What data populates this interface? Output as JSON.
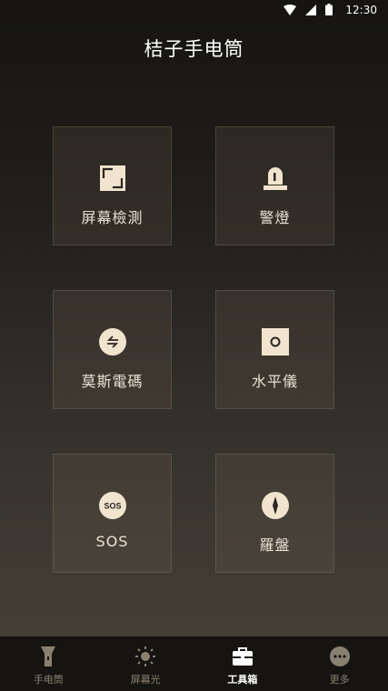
{
  "status_bar": {
    "time": "12:30",
    "icons": [
      "wifi-icon",
      "signal-icon",
      "battery-icon"
    ]
  },
  "app": {
    "title": "桔子手电筒"
  },
  "tools": [
    {
      "label": "屏幕檢測",
      "icon": "screen-frame-icon"
    },
    {
      "label": "警燈",
      "icon": "siren-icon"
    },
    {
      "label": "莫斯電碼",
      "icon": "swap-arrows-icon"
    },
    {
      "label": "水平儀",
      "icon": "level-icon"
    },
    {
      "label": "SOS",
      "icon": "sos-icon",
      "badge": "SOS"
    },
    {
      "label": "羅盤",
      "icon": "compass-icon"
    }
  ],
  "tab_bar": {
    "active_index": 2,
    "tabs": [
      {
        "label": "手电筒",
        "icon": "flashlight-icon"
      },
      {
        "label": "屏幕光",
        "icon": "sun-icon"
      },
      {
        "label": "工具箱",
        "icon": "toolbox-icon"
      },
      {
        "label": "更多",
        "icon": "more-icon"
      }
    ]
  },
  "colors": {
    "icon_fill": "#f1e4cf",
    "tab_active": "#ffffff",
    "tab_inactive": "#8a8072"
  }
}
